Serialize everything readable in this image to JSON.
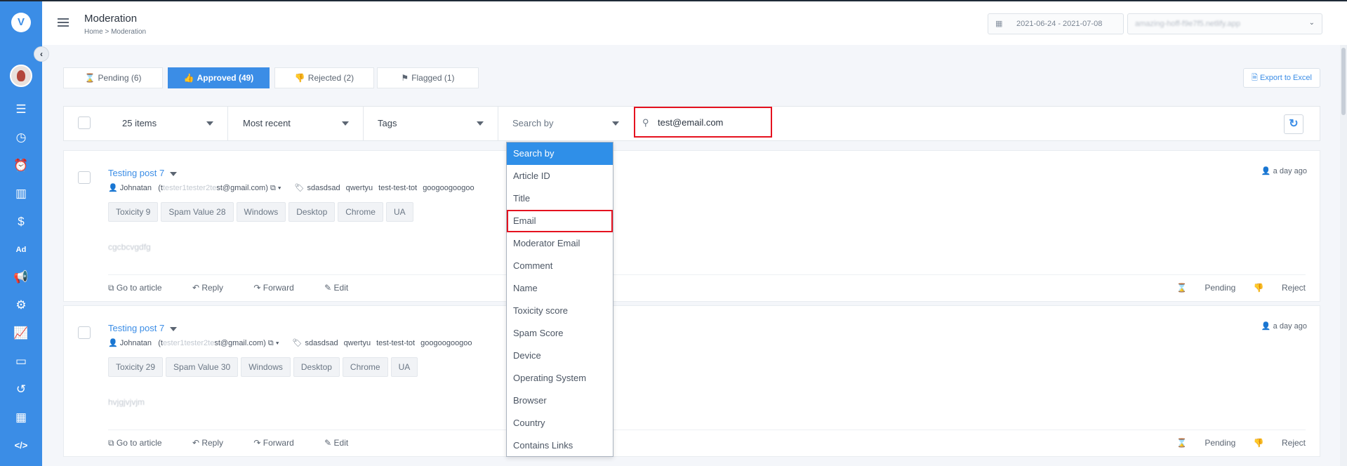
{
  "app": {
    "logo_text": "V",
    "page_title": "Moderation",
    "breadcrumb": "Home  > Moderation",
    "date_range": "2021-06-24 - 2021-07-08",
    "site_select": "amazing-hoff-f9e7f5.netlify.app"
  },
  "sidebar": {
    "icons": [
      "list-icon",
      "clock-icon",
      "alarm-icon",
      "book-icon",
      "dollar-icon",
      "ad-icon",
      "megaphone-icon",
      "gear-icon",
      "analytics-icon",
      "card-icon",
      "history-icon",
      "table-icon",
      "code-icon"
    ],
    "active": "megaphone-icon"
  },
  "tabs": [
    {
      "label": "Pending (6)",
      "icon": "hourglass-icon"
    },
    {
      "label": "Approved (49)",
      "icon": "thumbs-up-icon",
      "active": true
    },
    {
      "label": "Rejected (2)",
      "icon": "thumbs-down-icon"
    },
    {
      "label": "Flagged (1)",
      "icon": "flag-icon"
    }
  ],
  "export_label": "Export to Excel",
  "filters": {
    "items": "25 items",
    "sort": "Most recent",
    "tags": "Tags",
    "search_by": "Search by",
    "search_value": "test@email.com"
  },
  "dropdown": {
    "options": [
      "Search by",
      "Article ID",
      "Title",
      "Email",
      "Moderator Email",
      "Comment",
      "Name",
      "Toxicity score",
      "Spam Score",
      "Device",
      "Operating System",
      "Browser",
      "Country",
      "Contains Links"
    ],
    "selected": "Search by",
    "highlighted": "Email"
  },
  "posts": [
    {
      "title": "Testing post 7",
      "author": "Johnatan",
      "email_hidden": "tester1tester2te",
      "email_visible": "st@gmail.com)",
      "email_prefix": "(t",
      "tags": [
        "sdasdsad",
        "qwertyu",
        "test-test-tot",
        "googoogoogoo"
      ],
      "chips": [
        "Toxicity 9",
        "Spam Value 28",
        "Windows",
        "Desktop",
        "Chrome",
        "UA"
      ],
      "body": "cgcbcvgdfg",
      "time": "a day ago",
      "actions": [
        "Go to article",
        "Reply",
        "Forward",
        "Edit"
      ],
      "right_actions": [
        "Pending",
        "Reject"
      ]
    },
    {
      "title": "Testing post 7",
      "author": "Johnatan",
      "email_hidden": "ester1tester2te",
      "email_visible": "st@gmail.com)",
      "email_prefix": "(t",
      "tags": [
        "sdasdsad",
        "qwertyu",
        "test-test-tot",
        "googoogoogoo"
      ],
      "chips": [
        "Toxicity 29",
        "Spam Value 30",
        "Windows",
        "Desktop",
        "Chrome",
        "UA"
      ],
      "body": "hvjgjvjvjm",
      "time": "a day ago",
      "actions": [
        "Go to article",
        "Reply",
        "Forward",
        "Edit"
      ],
      "right_actions": [
        "Pending",
        "Reject"
      ]
    }
  ]
}
